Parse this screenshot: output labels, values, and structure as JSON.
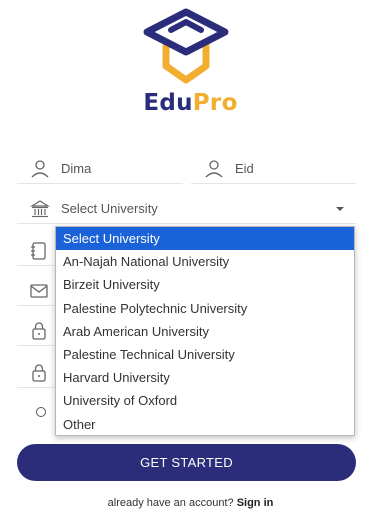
{
  "brand": {
    "name_part1": "Edu",
    "name_part2": "Pro",
    "primary_color": "#2b2d7a",
    "accent_color": "#f2ae30"
  },
  "form": {
    "first_name_value": "Dima",
    "last_name_value": "Eid",
    "university_value": "Select University"
  },
  "university_dropdown": {
    "options": [
      "Select University",
      "An-Najah National University",
      "Birzeit University",
      "Palestine Polytechnic University",
      "Arab American University",
      "Palestine Technical University",
      "Harvard University",
      "University of Oxford",
      "Other"
    ],
    "selected_index": 0,
    "highlight_color": "#1a62d8"
  },
  "cta": {
    "label": "GET STARTED"
  },
  "footer": {
    "prompt": "already have an account?",
    "link": "Sign in"
  },
  "icons": [
    "user-icon",
    "university-icon",
    "chevron-down-icon",
    "notebook-icon",
    "mail-icon",
    "lock-icon"
  ]
}
